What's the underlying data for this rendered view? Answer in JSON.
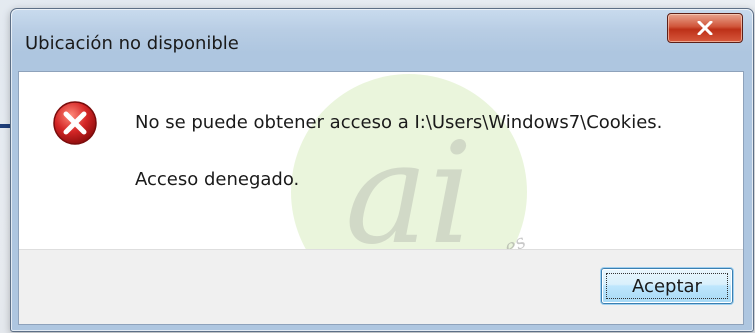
{
  "dialog": {
    "title": "Ubicación no disponible",
    "message": "No se puede obtener acceso a I:\\Users\\Windows7\\Cookies.",
    "detail": "Acceso denegado.",
    "ok_label": "Aceptar",
    "close_glyph": "X",
    "icon": "error-icon"
  },
  "watermark": {
    "logo_text": "ai",
    "url_text": "www.abueloinformatico.es"
  },
  "colors": {
    "title_bar": "#b8cde4",
    "close_button": "#c7422a",
    "error_icon": "#c81d1d",
    "watermark": "#8cc63f"
  }
}
